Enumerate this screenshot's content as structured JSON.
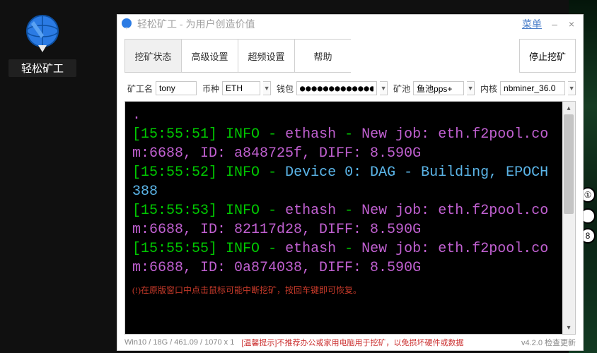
{
  "desktop": {
    "shortcut_label": "轻松矿工"
  },
  "window": {
    "title": "轻松矿工 - 为用户创造价值",
    "menu_label": "菜单",
    "minimize": "–",
    "close": "×"
  },
  "toolbar": {
    "tabs": [
      {
        "label": "挖矿状态",
        "active": true
      },
      {
        "label": "高级设置",
        "active": false
      },
      {
        "label": "超频设置",
        "active": false
      },
      {
        "label": "帮助",
        "active": false
      }
    ],
    "stop_label": "停止挖矿"
  },
  "config": {
    "miner_label": "矿工名",
    "miner_value": "tony",
    "coin_label": "币种",
    "coin_value": "ETH",
    "wallet_label": "钱包",
    "wallet_value": "●●●●●●●●●●●●●",
    "pool_label": "矿池",
    "pool_value": "鱼池pps+",
    "core_label": "内核",
    "core_value": "nbminer_36.0"
  },
  "terminal": {
    "lines": [
      {
        "ts": "[15:55:51]",
        "level": "INFO",
        "eth": "ethash",
        "detail": "New job: eth.f2pool.com:6688, ID: a848725f, DIFF: 8.590G"
      },
      {
        "ts": "[15:55:52]",
        "level": "INFO",
        "dev": "Device 0: DAG - Building, EPOCH 388"
      },
      {
        "ts": "[15:55:53]",
        "level": "INFO",
        "eth": "ethash",
        "detail": "New job: eth.f2pool.com:6688, ID: 82117d28, DIFF: 8.590G"
      },
      {
        "ts": "[15:55:55]",
        "level": "INFO",
        "eth": "ethash",
        "detail": "New job: eth.f2pool.com:6688, ID: 0a874038, DIFF: 8.590G"
      }
    ],
    "warning": "(!)在原版窗口中点击鼠标可能中断挖矿，按回车键即可恢复。"
  },
  "statusbar": {
    "system": "Win10  /  18G / 461.09  / 1070 x 1",
    "tip": "[温馨提示]不推荐办公或家用电脑用于挖矿，以免损坏硬件或数据",
    "version": "v4.2.0 检查更新"
  }
}
